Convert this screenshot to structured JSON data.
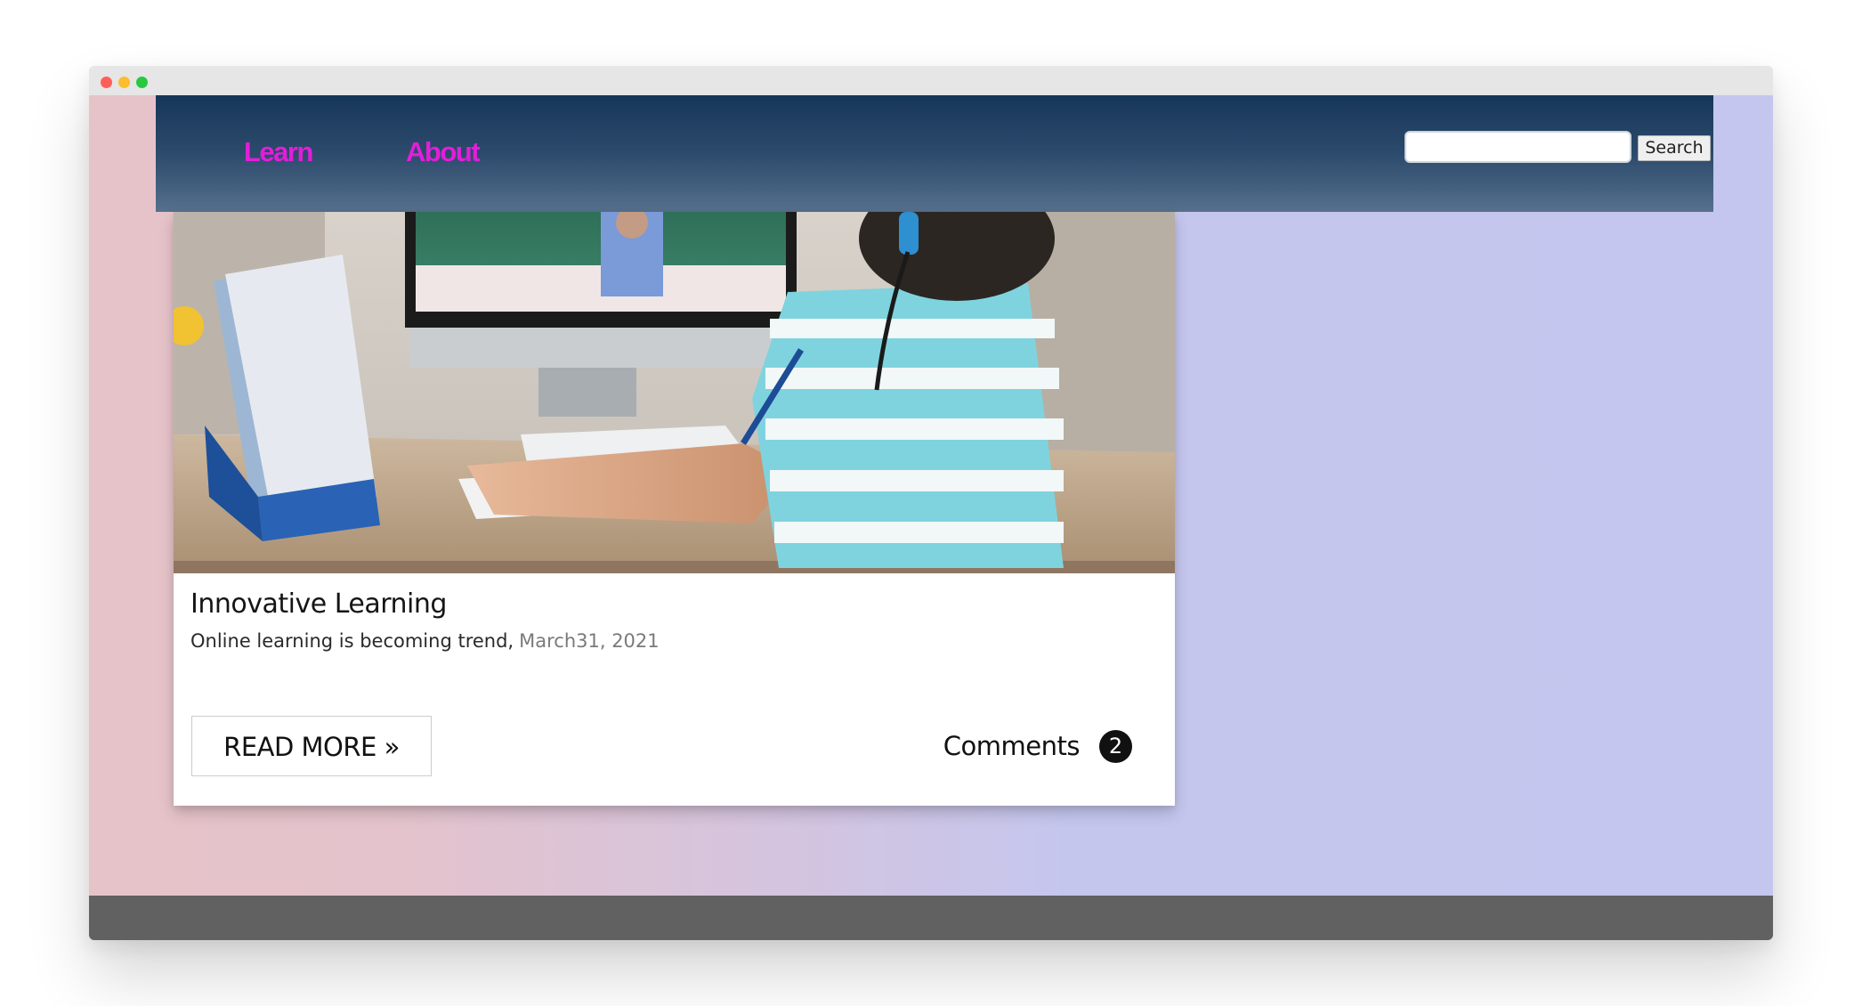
{
  "window": {
    "controls": [
      "close",
      "minimize",
      "maximize"
    ]
  },
  "nav": {
    "links": [
      {
        "label": "Learn"
      },
      {
        "label": "About"
      }
    ],
    "link_color": "#e21ed9",
    "search": {
      "value": "",
      "placeholder": "",
      "button_label": "Search"
    }
  },
  "card": {
    "image_alt": "Child in striped shirt with headphones attending an online class on a computer",
    "title": "Innovative Learning",
    "description": "Online learning is becoming trend,",
    "date": "March31, 2021",
    "read_more_label": "READ MORE »",
    "comments_label": "Comments",
    "comments_count": "2"
  },
  "colors": {
    "nav_top": "#163659",
    "nav_bottom": "#56708d",
    "background_left": "#e6c3c8",
    "background_right": "#c4c6ef",
    "footer": "#616161"
  }
}
